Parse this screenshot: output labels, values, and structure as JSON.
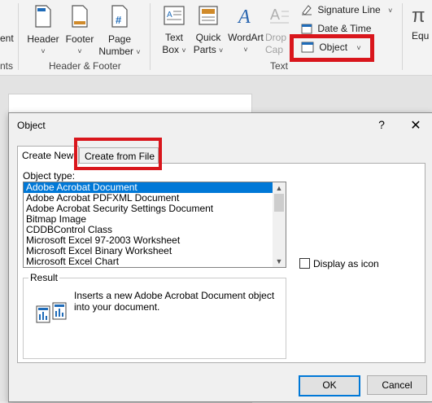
{
  "ribbon": {
    "left_cut_labels": [
      "ent",
      "nts"
    ],
    "header_footer": {
      "header_label": "Header",
      "footer_label": "Footer",
      "page_number_line1": "Page",
      "page_number_line2": "Number",
      "group_label": "Header & Footer",
      "page_number_icon_glyph": "#"
    },
    "text": {
      "text_box_line1": "Text",
      "text_box_line2": "Box",
      "quick_parts_line1": "Quick",
      "quick_parts_line2": "Parts",
      "wordart_label": "WordArt",
      "drop_cap_line1": "Drop",
      "drop_cap_line2": "Cap",
      "signature_line_label": "Signature Line",
      "date_time_label": "Date & Time",
      "object_label": "Object",
      "group_label": "Text",
      "caret": "˅"
    },
    "equation_cut_label": "Equ",
    "accent_color": "#d9161c"
  },
  "dialog": {
    "title": "Object",
    "help_glyph": "?",
    "close_glyph": "✕",
    "tabs": [
      {
        "label": "Create New",
        "active": true
      },
      {
        "label": "Create from File",
        "active": false
      }
    ],
    "object_type_label": "Object type:",
    "object_types": [
      "Adobe Acrobat Document",
      "Adobe Acrobat PDFXML Document",
      "Adobe Acrobat Security Settings Document",
      "Bitmap Image",
      "CDDBControl Class",
      "Microsoft Excel 97-2003 Worksheet",
      "Microsoft Excel Binary Worksheet",
      "Microsoft Excel Chart"
    ],
    "selected_index": 0,
    "display_as_icon_label": "Display as icon",
    "display_as_icon_checked": false,
    "result_label": "Result",
    "result_text": "Inserts a new Adobe Acrobat Document object into your document.",
    "ok_label": "OK",
    "cancel_label": "Cancel",
    "selection_color": "#0078d7"
  }
}
